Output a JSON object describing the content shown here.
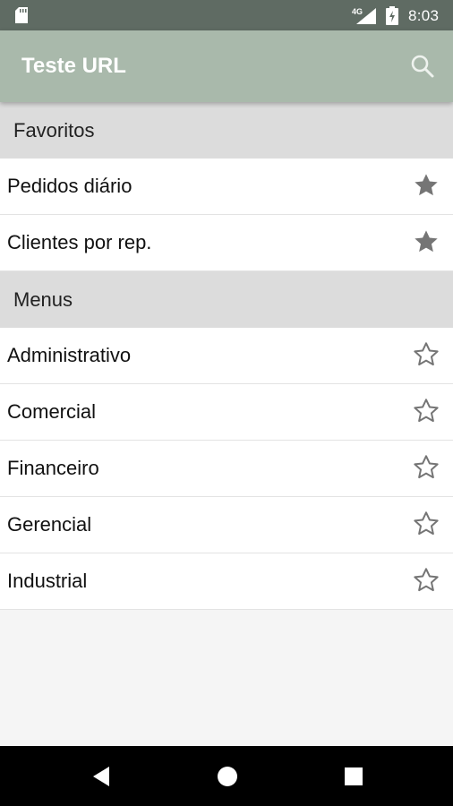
{
  "status_bar": {
    "network": "4G",
    "time": "8:03",
    "icons": [
      "sd-card-icon",
      "signal-icon",
      "battery-charging-icon"
    ]
  },
  "app_bar": {
    "title": "Teste URL",
    "search_icon": "search-icon"
  },
  "sections": [
    {
      "title": "Favoritos",
      "items": [
        {
          "label": "Pedidos diário",
          "favorite": true
        },
        {
          "label": "Clientes por rep.",
          "favorite": true
        }
      ]
    },
    {
      "title": "Menus",
      "items": [
        {
          "label": "Administrativo",
          "favorite": false
        },
        {
          "label": "Comercial",
          "favorite": false
        },
        {
          "label": "Financeiro",
          "favorite": false
        },
        {
          "label": "Gerencial",
          "favorite": false
        },
        {
          "label": "Industrial",
          "favorite": false
        }
      ]
    }
  ],
  "nav_bar": {
    "icons": [
      "back-icon",
      "home-icon",
      "recents-icon"
    ]
  },
  "colors": {
    "status_bar": "#5f6b63",
    "app_bar": "#a9b9ab",
    "section_header": "#dcdcdc",
    "star": "#757575"
  }
}
